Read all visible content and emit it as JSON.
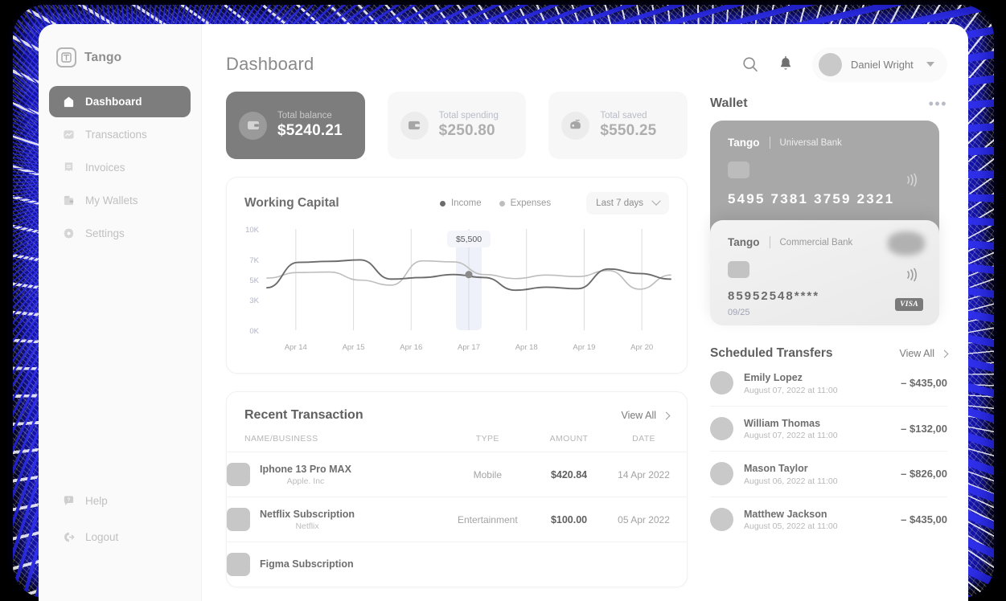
{
  "sidebar": {
    "brand": {
      "mark": "tango-logo-icon",
      "name": "Tango"
    },
    "items": [
      {
        "label": "Dashboard",
        "icon": "home-icon",
        "active": true
      },
      {
        "label": "Transactions",
        "icon": "transactions-icon",
        "active": false
      },
      {
        "label": "Invoices",
        "icon": "invoice-icon",
        "active": false
      },
      {
        "label": "My Wallets",
        "icon": "wallet-icon",
        "active": false
      },
      {
        "label": "Settings",
        "icon": "gear-icon",
        "active": false
      }
    ],
    "bottom_items": [
      {
        "label": "Help",
        "icon": "help-icon"
      },
      {
        "label": "Logout",
        "icon": "logout-icon"
      }
    ]
  },
  "header": {
    "title": "Dashboard",
    "search_icon": "search-icon",
    "notification_icon": "bell-icon",
    "user": {
      "name": "Daniel Wright",
      "caret": "chevron-down-icon"
    }
  },
  "stats": [
    {
      "label": "Total balance",
      "value": "$5240.21",
      "icon": "wallet-icon",
      "primary": true
    },
    {
      "label": "Total spending",
      "value": "$250.80",
      "icon": "wallet-icon",
      "primary": false
    },
    {
      "label": "Total saved",
      "value": "$550.25",
      "icon": "savings-icon",
      "primary": false
    }
  ],
  "chart_card": {
    "title": "Working Capital",
    "legend": [
      {
        "label": "Income",
        "color": "#6b6b6b"
      },
      {
        "label": "Expenses",
        "color": "#bdbdbd"
      }
    ],
    "range": {
      "value": "Last 7 days",
      "icon": "chevron-down-icon"
    }
  },
  "chart_data": {
    "type": "line",
    "title": "Working Capital",
    "xlabel": "",
    "ylabel": "",
    "grid": "vertical",
    "legend_position": "top-right",
    "categories": [
      "Apr 14",
      "Apr 15",
      "Apr 16",
      "Apr 17",
      "Apr 18",
      "Apr 19",
      "Apr 20"
    ],
    "ytick_labels": [
      "0K",
      "3K",
      "5K",
      "7K",
      "10K"
    ],
    "ytick_values": [
      0,
      3000,
      5000,
      7000,
      10000
    ],
    "ylim": [
      0,
      10000
    ],
    "annotation": {
      "label": "$5,500",
      "value": 5500,
      "x": "Apr 17",
      "series": "Expenses"
    },
    "series": [
      {
        "name": "Income",
        "color": "#6b6b6b",
        "x": [
          "Apr 13.6",
          "Apr 14",
          "Apr 14.5",
          "Apr 15",
          "Apr 15.5",
          "Apr 16",
          "Apr 16.5",
          "Apr 17",
          "Apr 17.5",
          "Apr 18",
          "Apr 18.5",
          "Apr 19",
          "Apr 19.5",
          "Apr 20"
        ],
        "values": [
          4200,
          6700,
          6800,
          6950,
          5050,
          5200,
          5500,
          5200,
          3950,
          4250,
          4100,
          6050,
          5600,
          5050
        ]
      },
      {
        "name": "Expenses",
        "color": "#bdbdbd",
        "x": [
          "Apr 13.6",
          "Apr 14",
          "Apr 14.5",
          "Apr 15",
          "Apr 15.5",
          "Apr 16",
          "Apr 16.5",
          "Apr 17",
          "Apr 17.5",
          "Apr 18",
          "Apr 18.5",
          "Apr 19",
          "Apr 19.5",
          "Apr 20"
        ],
        "values": [
          5150,
          5700,
          5750,
          4950,
          4450,
          6850,
          6750,
          5500,
          5100,
          5450,
          5300,
          5900,
          4050,
          5450
        ]
      }
    ]
  },
  "recent_transactions": {
    "title": "Recent Transaction",
    "view_all": "View All",
    "columns": [
      "NAME/BUSINESS",
      "TYPE",
      "AMOUNT",
      "DATE"
    ],
    "rows": [
      {
        "name": "Iphone 13 Pro MAX",
        "business": "Apple. Inc",
        "type": "Mobile",
        "amount": "$420.84",
        "date": "14 Apr 2022"
      },
      {
        "name": "Netflix Subscription",
        "business": "Netflix",
        "type": "Entertainment",
        "amount": "$100.00",
        "date": "05 Apr 2022"
      },
      {
        "name": "Figma Subscription",
        "business": "",
        "type": "",
        "amount": "",
        "date": ""
      }
    ]
  },
  "wallet": {
    "title": "Wallet",
    "menu_icon": "more-horizontal-icon",
    "cards": [
      {
        "brand": "Tango",
        "bank": "Universal Bank",
        "number": "5495 7381 3759 2321",
        "expiry": "",
        "network": ""
      },
      {
        "brand": "Tango",
        "bank": "Commercial Bank",
        "number": "85952548****",
        "expiry": "09/25",
        "network": "VISA"
      }
    ]
  },
  "scheduled_transfers": {
    "title": "Scheduled Transfers",
    "view_all": "View All",
    "rows": [
      {
        "name": "Emily Lopez",
        "when": "August 07, 2022 at 11:00",
        "amount": "–  $435,00"
      },
      {
        "name": "William Thomas",
        "when": "August 07, 2022 at 11:00",
        "amount": "–  $132,00"
      },
      {
        "name": "Mason Taylor",
        "when": "August 06, 2022 at 11:00",
        "amount": "–  $826,00"
      },
      {
        "name": "Matthew Jackson",
        "when": "August 05, 2022 at 11:00",
        "amount": "–  $435,00"
      }
    ]
  }
}
